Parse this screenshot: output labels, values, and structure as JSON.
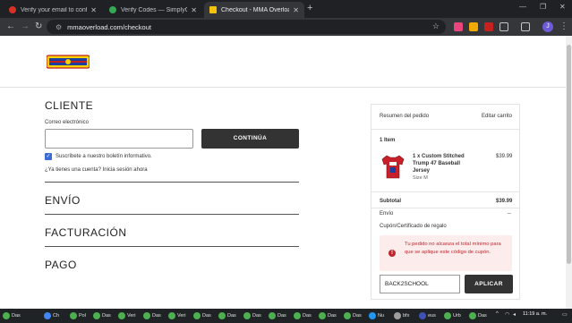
{
  "browser": {
    "tabs": [
      {
        "title": "Verify your email to confirm yo",
        "color": "#d93025"
      },
      {
        "title": "Verify Codes — SimplyCodes",
        "color": "#34a853"
      },
      {
        "title": "Checkout - MMA Overload",
        "color": "#f4c20d"
      }
    ],
    "new_tab": "+",
    "url": "mmaoverload.com/checkout",
    "profile_initial": "J"
  },
  "checkout": {
    "customer_title": "CLIENTE",
    "email_label": "Correo electrónico",
    "email_value": "",
    "continue_label": "CONTINÚA",
    "newsletter_label": "Suscríbete a nuestro boletín informativo.",
    "login_prompt": "¿Ya tienes una cuenta? Inicia sesión ahora",
    "shipping_title": "ENVÍO",
    "billing_title": "FACTURACIÓN",
    "payment_title": "PAGO"
  },
  "summary": {
    "title": "Resumen del pedido",
    "edit_label": "Editar carrito",
    "item_count": "1 Item",
    "item_name": "1 x Custom Stitched Trump 47 Baseball Jersey",
    "item_size": "Size M",
    "item_price": "$39.99",
    "subtotal_label": "Subtotal",
    "subtotal_value": "$39.99",
    "shipping_label": "Envío",
    "shipping_value": "--",
    "coupon_label": "Cupón/Certificado de regalo",
    "error_message": "Tu pedido no alcanza el total mínimo para que se aplique este código de cupón.",
    "coupon_value": "BACK2SCHOOL",
    "apply_label": "APLICAR"
  },
  "taskbar": {
    "items": [
      {
        "label": "Das",
        "color": "#4caf50"
      },
      {
        "label": "Ch",
        "color": "#4285f4"
      },
      {
        "label": "Pol",
        "color": "#4caf50"
      },
      {
        "label": "Das",
        "color": "#4caf50"
      },
      {
        "label": "Veri",
        "color": "#4caf50"
      },
      {
        "label": "Das",
        "color": "#4caf50"
      },
      {
        "label": "Veri",
        "color": "#4caf50"
      },
      {
        "label": "Das",
        "color": "#4caf50"
      },
      {
        "label": "Das",
        "color": "#4caf50"
      },
      {
        "label": "Das",
        "color": "#4caf50"
      },
      {
        "label": "Das",
        "color": "#4caf50"
      },
      {
        "label": "Das",
        "color": "#4caf50"
      },
      {
        "label": "Das",
        "color": "#4caf50"
      },
      {
        "label": "Das",
        "color": "#4caf50"
      },
      {
        "label": "Nu",
        "color": "#2196f3"
      },
      {
        "label": "bfx",
        "color": "#9e9e9e"
      },
      {
        "label": "eus",
        "color": "#3f51b5"
      },
      {
        "label": "Urb",
        "color": "#4caf50"
      },
      {
        "label": "Das",
        "color": "#4caf50"
      }
    ],
    "time": "11:19 a. m."
  }
}
